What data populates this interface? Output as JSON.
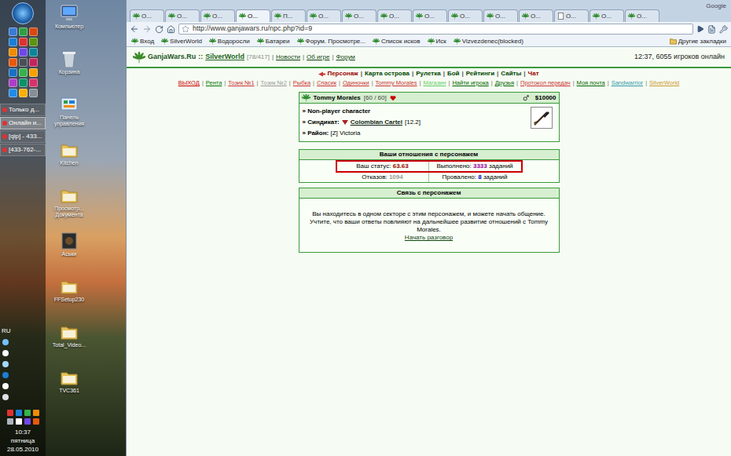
{
  "taskbar": {
    "buttons": [
      {
        "label": "Только д...",
        "selected": false
      },
      {
        "label": "Онлайн и...",
        "selected": true
      },
      {
        "label": "[qip] - 433...",
        "selected": false
      },
      {
        "label": "[433-762-...",
        "selected": false
      }
    ],
    "language": "RU",
    "clock": {
      "time": "10:37",
      "day": "пятница",
      "date": "28.05.2010"
    }
  },
  "desktop": {
    "icons": [
      {
        "label": "Компьютер",
        "kind": "computer"
      },
      {
        "label": "Корзина",
        "kind": "trash"
      },
      {
        "label": "Панель управления",
        "kind": "control"
      },
      {
        "label": "Kitchen",
        "kind": "folder"
      },
      {
        "label": "Просмотр... Документа",
        "kind": "folder"
      },
      {
        "label": "Аськи",
        "kind": "dark"
      },
      {
        "label": "FFSetup230",
        "kind": "folder"
      },
      {
        "label": "Total_Video...",
        "kind": "folder"
      },
      {
        "label": "TVC361",
        "kind": "folder"
      }
    ]
  },
  "browser": {
    "brand": "Google",
    "tabs": [
      {
        "label": "О...",
        "selected": false,
        "kind": "leaf"
      },
      {
        "label": "О...",
        "selected": false,
        "kind": "leaf"
      },
      {
        "label": "О...",
        "selected": false,
        "kind": "leaf"
      },
      {
        "label": "О...",
        "selected": true,
        "kind": "leaf"
      },
      {
        "label": "П...",
        "selected": false,
        "kind": "leaf"
      },
      {
        "label": "О...",
        "selected": false,
        "kind": "leaf"
      },
      {
        "label": "О...",
        "selected": false,
        "kind": "leaf"
      },
      {
        "label": "О...",
        "selected": false,
        "kind": "leaf"
      },
      {
        "label": "О...",
        "selected": false,
        "kind": "leaf"
      },
      {
        "label": "О...",
        "selected": false,
        "kind": "leaf"
      },
      {
        "label": "О...",
        "selected": false,
        "kind": "leaf"
      },
      {
        "label": "О...",
        "selected": false,
        "kind": "leaf"
      },
      {
        "label": "О...",
        "selected": false,
        "kind": "doc"
      },
      {
        "label": "О...",
        "selected": false,
        "kind": "leaf"
      },
      {
        "label": "О...",
        "selected": false,
        "kind": "leaf"
      }
    ],
    "url": "http://www.ganjawars.ru/npc.php?id=9",
    "bookmarks": [
      "Вход",
      "SilverWorld",
      "Водоросли",
      "Батареи",
      "Форум. Просмотре...",
      "Список исков",
      "Иск",
      "Vizvezdenec(blocked)"
    ],
    "other_bookmarks": "Другие закладки"
  },
  "page": {
    "header": {
      "site": "GanjaWars.Ru",
      "separator": "::",
      "world": "SilverWorld",
      "world_stats": "[78/417]",
      "link_separator": "|",
      "links": [
        "Новости",
        "Об игре",
        "Форум"
      ],
      "online": "12:37, 6055 игроков онлайн"
    },
    "nav": {
      "separator": "|",
      "items": [
        {
          "label": "Персонаж",
          "selected": true,
          "color": "#990000"
        },
        {
          "label": "Карта острова",
          "selected": false,
          "color": "#004400"
        },
        {
          "label": "Рулетка",
          "selected": false,
          "color": "#004400"
        },
        {
          "label": "Бой",
          "selected": false,
          "color": "#004400"
        },
        {
          "label": "Рейтинги",
          "selected": false,
          "color": "#004400"
        },
        {
          "label": "Сайты",
          "selected": false,
          "color": "#004400"
        },
        {
          "label": "Чат",
          "selected": false,
          "color": "#990000"
        }
      ]
    },
    "sub_nav": {
      "separator": "|",
      "items": [
        {
          "label": "ВЫХОД",
          "color": "#cc0000"
        },
        {
          "label": "Рента",
          "color": "#007700"
        },
        {
          "label": "Тозик №1",
          "color": "#cc3333"
        },
        {
          "label": "Тозик №2",
          "color": "#999999"
        },
        {
          "label": "Рыбка",
          "color": "#cc3333"
        },
        {
          "label": "Спасик",
          "color": "#cc3333"
        },
        {
          "label": "Одиночки",
          "color": "#cc3333"
        },
        {
          "label": "Tommy Morales",
          "color": "#cc3333"
        },
        {
          "label": "Магазин",
          "color": "#66cc66"
        },
        {
          "label": "Найти игрока",
          "color": "#006600"
        },
        {
          "label": "Друзья",
          "color": "#006600"
        },
        {
          "label": "Протокол передач",
          "color": "#cc3333"
        },
        {
          "label": "Моя почта",
          "color": "#006600"
        },
        {
          "label": "Sandwarrior",
          "color": "#3399aa"
        },
        {
          "label": "SilverWorld",
          "color": "#cc9933"
        }
      ]
    },
    "npc": {
      "name": "Tommy Morales",
      "hp": "[60 / 60]",
      "money": "$10000",
      "bullet": "»",
      "type": "Non-player character",
      "syndicate_label": "Синдикат:",
      "syndicate": "Colombian Cartel",
      "syndicate_level": "[12.2]",
      "district_label": "Район:",
      "district": "[Z] Victoria"
    },
    "relations": {
      "title": "Ваши отношения с персонажем",
      "rows": [
        {
          "highlighted": true,
          "cells": [
            {
              "label": "Ваш статус:",
              "value": "63.63",
              "suffix": "",
              "color": "#990000"
            },
            {
              "label": "Выполнено:",
              "value": "3333",
              "suffix": "заданий",
              "color": "#990099"
            }
          ]
        },
        {
          "highlighted": false,
          "cells": [
            {
              "label": "Отказов:",
              "value": "1094",
              "suffix": "",
              "color": "#999999"
            },
            {
              "label": "Провалено:",
              "value": "8",
              "suffix": "заданий",
              "color": "#0000cc"
            }
          ]
        }
      ]
    },
    "contact": {
      "title": "Связь с персонажем",
      "text": "Вы находитесь в одном секторе с этим персонажем, и можете начать общение. Учтите, что ваши ответы повлияют на дальнейшее развитие отношений с Tommy Morales.",
      "link": "Начать разговор"
    }
  }
}
